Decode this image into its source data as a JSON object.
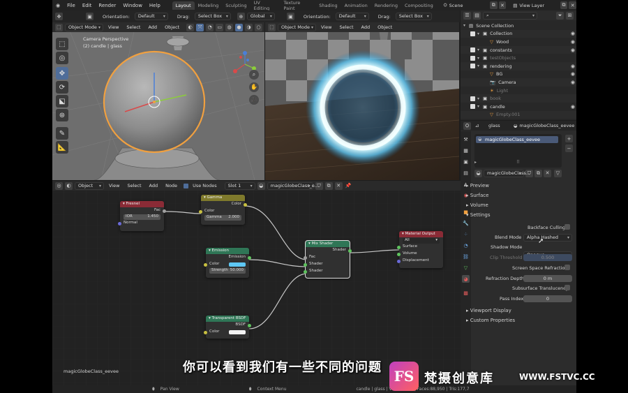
{
  "menu": {
    "file": "File",
    "edit": "Edit",
    "render": "Render",
    "window": "Window",
    "help": "Help"
  },
  "workspaces": [
    "Layout",
    "Modeling",
    "Sculpting",
    "UV Editing",
    "Texture Paint",
    "Shading",
    "Animation",
    "Rendering",
    "Compositing"
  ],
  "active_workspace": "Layout",
  "scene": "Scene",
  "view_layer": "View Layer",
  "tool_header": {
    "orientation_label": "Orientation:",
    "orientation_value": "Default",
    "drag_label": "Drag:",
    "drag_value": "Select Box",
    "transform_value": "Global"
  },
  "viewport_left": {
    "mode": "Object Mode",
    "menus": [
      "View",
      "Select",
      "Add",
      "Object"
    ],
    "overlay_line1": "Camera Perspective",
    "overlay_line2": "(2) candle | glass"
  },
  "viewport_right": {
    "mode": "Object Mode",
    "menus": [
      "View",
      "Select",
      "Add",
      "Object"
    ]
  },
  "node_editor": {
    "mode": "Object",
    "menus": [
      "View",
      "Select",
      "Add",
      "Node"
    ],
    "use_nodes": "Use Nodes",
    "slot": "Slot 1",
    "material": "magicGlobeClass_e...",
    "material_name_label": "magicGlobeClass_eevee"
  },
  "nodes": {
    "fresnel": {
      "title": "Fresnel",
      "out_fac": "Fac",
      "ior_label": "IOR",
      "ior_value": "1.450",
      "normal": "Normal"
    },
    "gamma": {
      "title": "Gamma",
      "out_color": "Color",
      "in_color": "Color",
      "gamma_label": "Gamma",
      "gamma_value": "2.000"
    },
    "emission": {
      "title": "Emission",
      "out_emission": "Emission",
      "color": "Color",
      "strength_label": "Strength",
      "strength_value": "50.000"
    },
    "transparent": {
      "title": "Transparent BSDF",
      "out_bsdf": "BSDF",
      "color": "Color"
    },
    "mix": {
      "title": "Mix Shader",
      "out_shader": "Shader",
      "fac": "Fac",
      "shader1": "Shader",
      "shader2": "Shader"
    },
    "output": {
      "title": "Material Output",
      "target": "All",
      "surface": "Surface",
      "volume": "Volume",
      "displacement": "Displacement"
    }
  },
  "outliner": {
    "rows": [
      {
        "label": "Scene Collection",
        "indent": 0,
        "type": "root",
        "dim": false
      },
      {
        "label": "Collection",
        "indent": 1,
        "type": "collection",
        "dim": false
      },
      {
        "label": "Wood",
        "indent": 2,
        "type": "object",
        "dim": false
      },
      {
        "label": "constants",
        "indent": 1,
        "type": "collection",
        "dim": false
      },
      {
        "label": "testObjects",
        "indent": 1,
        "type": "collection",
        "dim": true
      },
      {
        "label": "rendering",
        "indent": 1,
        "type": "collection",
        "dim": false
      },
      {
        "label": "BG",
        "indent": 2,
        "type": "object",
        "dim": false
      },
      {
        "label": "Camera",
        "indent": 2,
        "type": "camera",
        "dim": false
      },
      {
        "label": "Light",
        "indent": 2,
        "type": "light",
        "dim": true
      },
      {
        "label": "book",
        "indent": 1,
        "type": "collection",
        "dim": true
      },
      {
        "label": "candle",
        "indent": 1,
        "type": "collection",
        "dim": false
      },
      {
        "label": "Empty.001",
        "indent": 2,
        "type": "object",
        "dim": true
      }
    ]
  },
  "properties": {
    "object": "glass",
    "material": "magicGlobeClass_eevee",
    "slot_material": "magicGlobeClass_eevee",
    "material_field": "magicGlobeClass...",
    "sections": {
      "preview": "Preview",
      "surface": "Surface",
      "volume": "Volume",
      "settings": "Settings",
      "viewport_display": "Viewport Display",
      "custom_properties": "Custom Properties"
    },
    "backface_culling": "Backface Culling",
    "blend_mode_label": "Blend Mode",
    "blend_mode_value": "Alpha Hashed",
    "shadow_mode_label": "Shadow Mode",
    "shadow_mode_value": "Opaque",
    "clip_threshold_label": "Clip Threshold",
    "clip_threshold_value": "0.500",
    "ssr": "Screen Space Refraction",
    "refraction_depth_label": "Refraction Depth",
    "refraction_depth_value": "0 m",
    "sss_translucency": "Subsurface Translucency",
    "pass_index_label": "Pass Index",
    "pass_index_value": "0"
  },
  "status_bar": {
    "pan": "Pan View",
    "context": "Context Menu",
    "stats": "candle | glass | Verts:88,07 | Faces:88,950 | Tris:177,7"
  },
  "subtitle": "你可以看到我们有一些不同的问题",
  "watermark": {
    "brand": "梵摄创意库",
    "url": "WWW.FSTVC.CC",
    "logo": "FS"
  },
  "colors": {
    "accent": "#4f6d99",
    "selection_orange": "#f0a040",
    "fresnel_header": "#8a2b36",
    "gamma_header": "#7f7a2c",
    "emission_header": "#2f7656",
    "transparent_header": "#2f7656",
    "mix_header": "#2f7656",
    "output_header": "#8a2b36"
  }
}
